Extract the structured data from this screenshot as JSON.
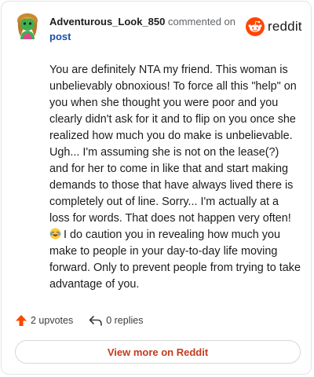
{
  "comment": {
    "username": "Adventurous_Look_850",
    "action": "commented on",
    "target": "post",
    "avatar_icon": "snoo-avatar-icon",
    "body_parts": [
      "You are definitely NTA my friend. This woman is unbelievably obnoxious! To force all this \"help\" on you when she thought you were poor and you clearly didn't ask for it and to flip on you once she realized how much you do make is unbelievable. Ugh... I'm assuming she is not on the lease(?) and for her to come in like that and start making demands to those that have always lived there is completely out of line. Sorry... I'm actually at a loss for words. That does not happen very often!",
      "I do caution you in revealing how much you make to people in your day-to-day life moving forward. Only to prevent people from trying to take advantage of you."
    ],
    "emoji_icon": "laughing-crying-emoji-icon"
  },
  "brand": {
    "name": "reddit",
    "icon": "reddit-logo-icon",
    "color": "#ff4500"
  },
  "footer": {
    "upvotes": "2 upvotes",
    "replies": "0 replies",
    "upvote_icon": "upvote-arrow-icon",
    "reply_icon": "reply-arrow-icon",
    "upvote_color": "#ff4500"
  },
  "cta": {
    "label": "View more on Reddit",
    "color": "#c43b1c"
  }
}
